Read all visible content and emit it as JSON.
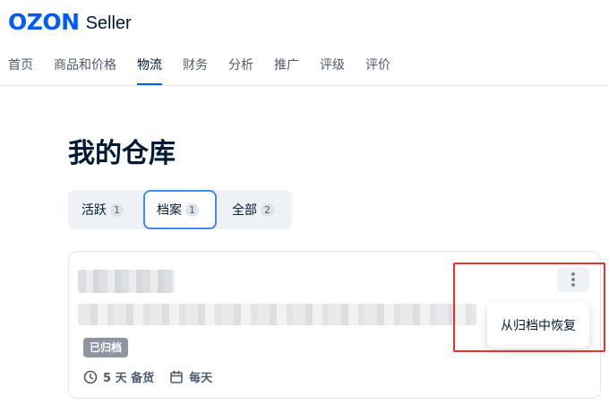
{
  "header": {
    "logo_ozon": "OZON",
    "logo_seller": "Seller"
  },
  "nav": {
    "items": [
      {
        "label": "首页"
      },
      {
        "label": "商品和价格"
      },
      {
        "label": "物流",
        "active": true
      },
      {
        "label": "财务"
      },
      {
        "label": "分析"
      },
      {
        "label": "推广"
      },
      {
        "label": "评级"
      },
      {
        "label": "评价"
      }
    ]
  },
  "page": {
    "title": "我的仓库"
  },
  "tabs": [
    {
      "label": "活跃",
      "count": "1"
    },
    {
      "label": "档案",
      "count": "1",
      "selected": true
    },
    {
      "label": "全部",
      "count": "2"
    }
  ],
  "warehouse": {
    "name": "",
    "address": "",
    "status_badge": "已归档",
    "prep_time": "5 天 备货",
    "schedule": "每天"
  },
  "menu": {
    "restore_label": "从归档中恢复"
  },
  "colors": {
    "brand": "#005bff",
    "highlight": "#e3342f",
    "badge": "#8d96a1"
  }
}
